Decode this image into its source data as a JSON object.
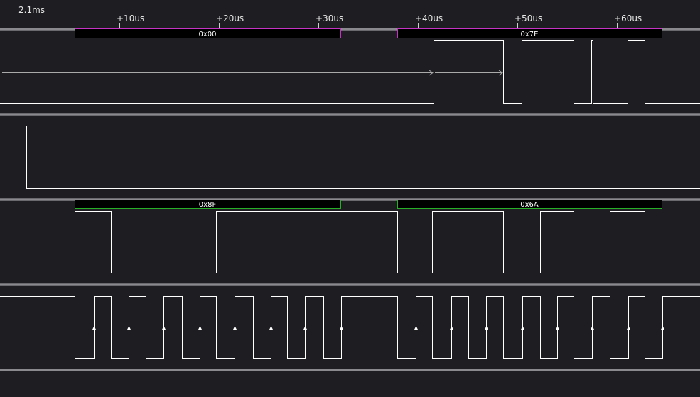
{
  "ruler": {
    "abs_time": "2.1ms",
    "ticks": [
      "+10us",
      "+20us",
      "+30us",
      "+40us",
      "+50us",
      "+60us"
    ]
  },
  "channels": [
    {
      "id": "mosi",
      "decode_color": "#c433c4",
      "bytes": [
        "0x00",
        "0x7E"
      ]
    },
    {
      "id": "enable"
    },
    {
      "id": "miso",
      "decode_color": "#27b027",
      "bytes": [
        "0x8F",
        "0x6A"
      ]
    },
    {
      "id": "clock"
    }
  ]
}
